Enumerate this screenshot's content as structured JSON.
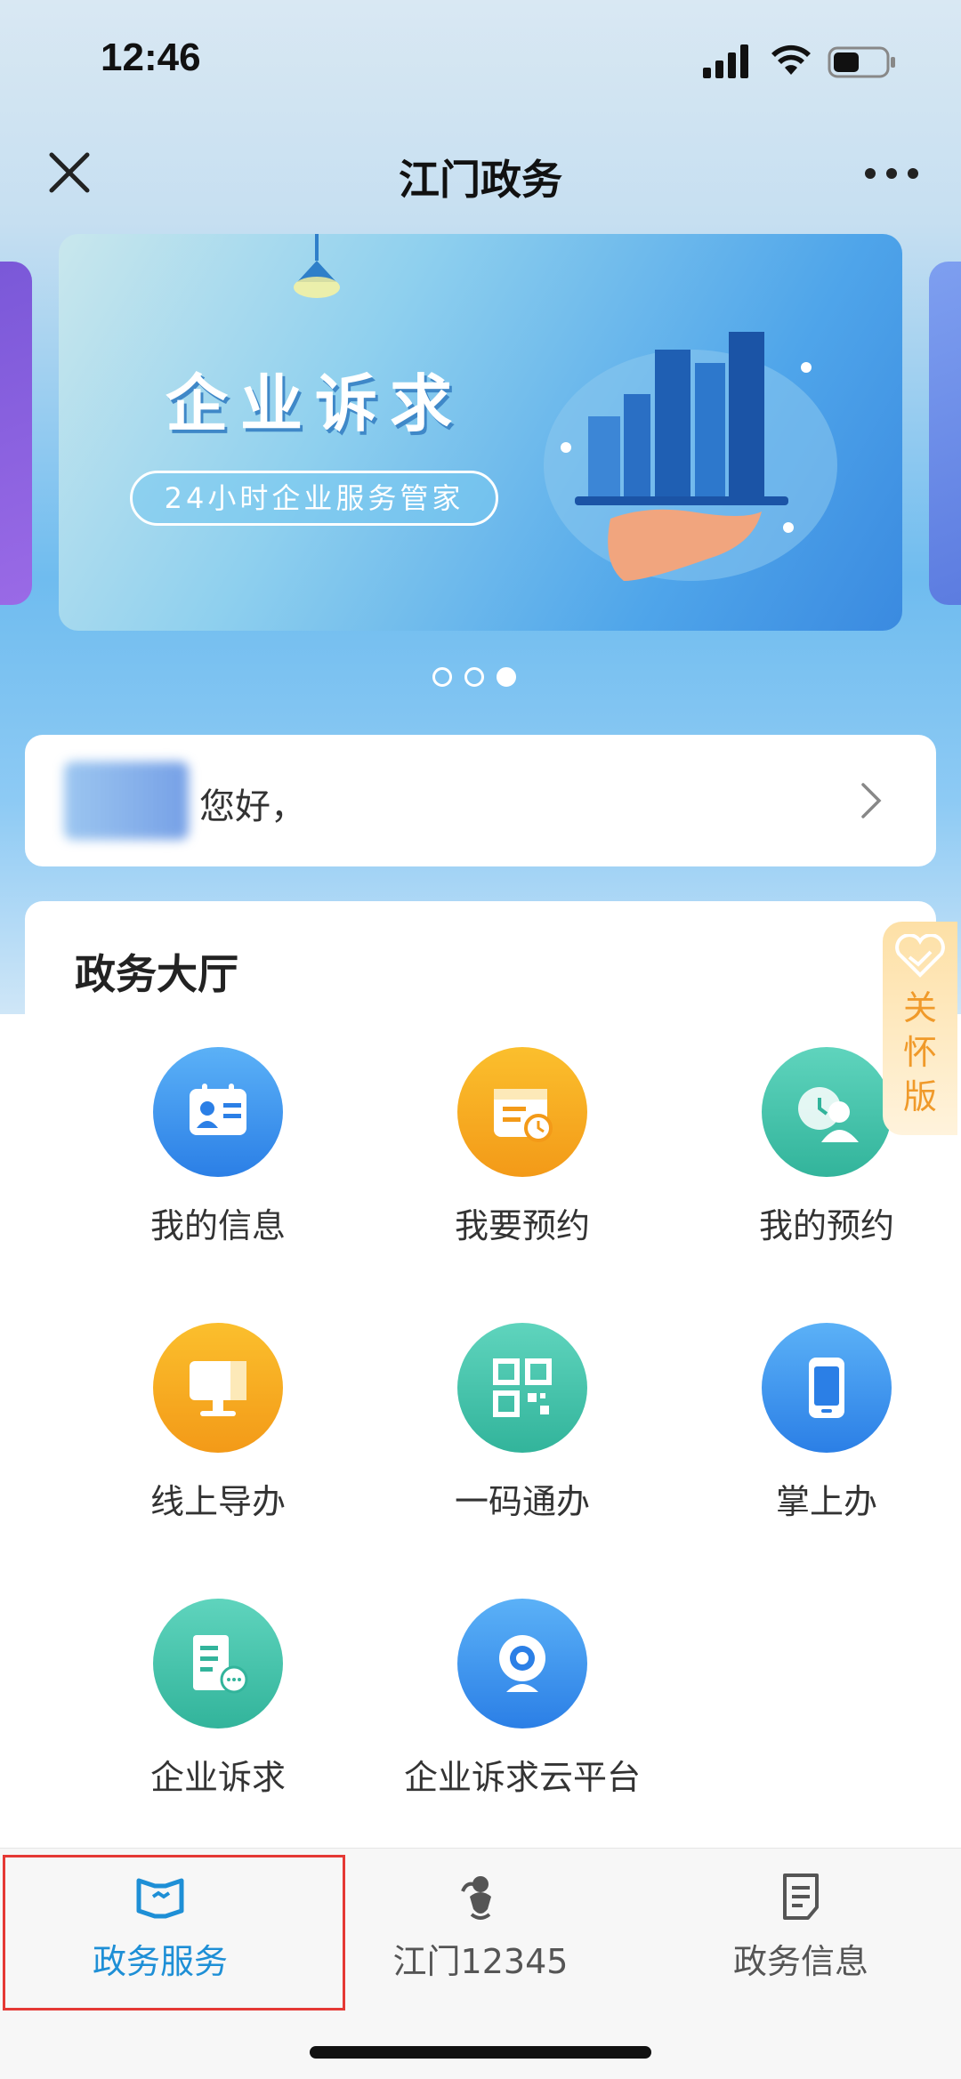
{
  "status_bar": {
    "time": "12:46"
  },
  "nav": {
    "title": "江门政务"
  },
  "banner": {
    "title": "企业诉求",
    "subtitle": "24小时企业服务管家",
    "page_count": 3,
    "active_page": 3
  },
  "greeting": {
    "text": "您好，"
  },
  "hall": {
    "title": "政务大厅",
    "items": [
      {
        "label": "我的信息",
        "icon": "id-card-icon",
        "color": "blue"
      },
      {
        "label": "我要预约",
        "icon": "calendar-clock-icon",
        "color": "orange"
      },
      {
        "label": "我的预约",
        "icon": "appointment-person-icon",
        "color": "teal"
      },
      {
        "label": "线上导办",
        "icon": "computer-monitor-icon",
        "color": "orange"
      },
      {
        "label": "一码通办",
        "icon": "qr-code-icon",
        "color": "teal"
      },
      {
        "label": "掌上办",
        "icon": "mobile-phone-icon",
        "color": "blue"
      },
      {
        "label": "企业诉求",
        "icon": "building-chat-icon",
        "color": "teal"
      },
      {
        "label": "企业诉求云平台",
        "icon": "webcam-icon",
        "color": "blue"
      }
    ]
  },
  "care_badge": {
    "label": "关怀版"
  },
  "tabbar": {
    "tabs": [
      {
        "label": "政务服务",
        "icon": "book-flag-icon",
        "active": true
      },
      {
        "label": "江门12345",
        "icon": "phone-mascot-icon",
        "active": false
      },
      {
        "label": "政务信息",
        "icon": "document-icon",
        "active": false
      }
    ]
  },
  "colors": {
    "accent": "#1e8fd6",
    "highlight_border": "#e53935",
    "care": "#f09a2a"
  }
}
